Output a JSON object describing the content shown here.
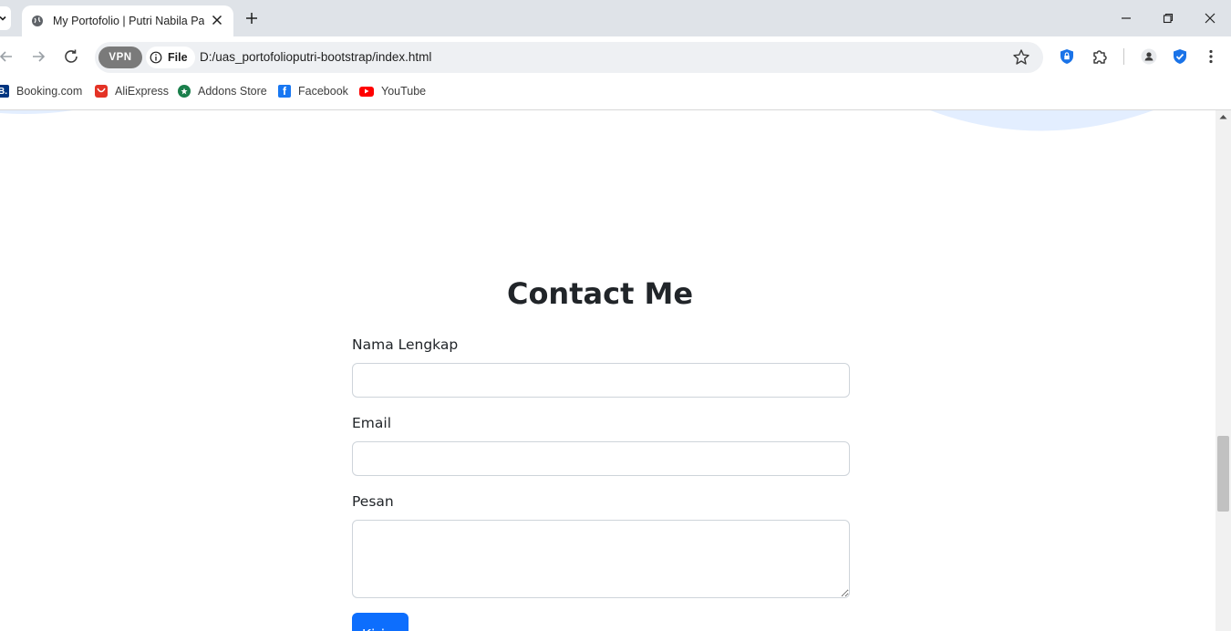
{
  "browser": {
    "tab": {
      "title": "My Portofolio | Putri Nabila Pas"
    },
    "address": {
      "vpn_label": "VPN",
      "scheme_label": "File",
      "url": "D:/uas_portofolioputri-bootstrap/index.html"
    },
    "bookmarks": [
      {
        "label": "Booking.com",
        "icon": "booking-icon",
        "color": "#003580"
      },
      {
        "label": "AliExpress",
        "icon": "aliexpress-icon",
        "color": "#e43225"
      },
      {
        "label": "Addons Store",
        "icon": "addons-icon",
        "color": "#1a7f4b"
      },
      {
        "label": "Facebook",
        "icon": "facebook-icon",
        "color": "#1877f2"
      },
      {
        "label": "YouTube",
        "icon": "youtube-icon",
        "color": "#ff0000"
      }
    ]
  },
  "page": {
    "contact": {
      "title": "Contact Me",
      "fields": [
        {
          "label": "Nama Lengkap",
          "value": "",
          "type": "text"
        },
        {
          "label": "Email",
          "value": "",
          "type": "email"
        },
        {
          "label": "Pesan",
          "value": "",
          "type": "textarea"
        }
      ],
      "submit_label": "Kirim"
    }
  },
  "colors": {
    "primary": "#0d6efd",
    "wave": "#e3eeff"
  }
}
